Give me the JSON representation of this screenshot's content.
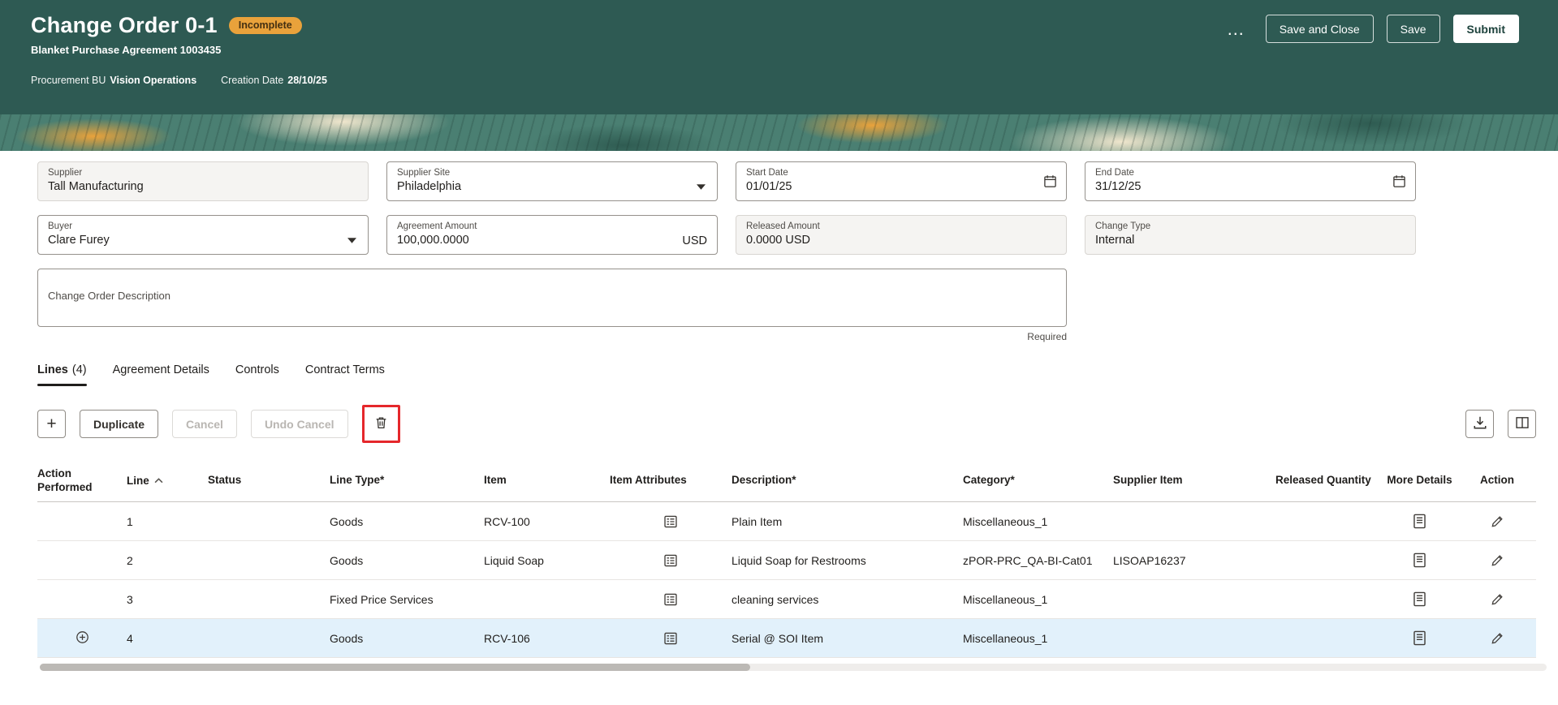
{
  "header": {
    "title": "Change Order 0-1",
    "status_badge": "Incomplete",
    "subtitle": "Blanket Purchase Agreement 1003435",
    "meta": {
      "procurement_bu_label": "Procurement BU",
      "procurement_bu_value": "Vision Operations",
      "creation_date_label": "Creation Date",
      "creation_date_value": "28/10/25"
    },
    "actions": {
      "more": "…",
      "save_and_close": "Save and Close",
      "save": "Save",
      "submit": "Submit"
    }
  },
  "form": {
    "supplier": {
      "label": "Supplier",
      "value": "Tall Manufacturing"
    },
    "supplier_site": {
      "label": "Supplier Site",
      "value": "Philadelphia"
    },
    "start_date": {
      "label": "Start Date",
      "value": "01/01/25"
    },
    "end_date": {
      "label": "End Date",
      "value": "31/12/25"
    },
    "buyer": {
      "label": "Buyer",
      "value": "Clare Furey"
    },
    "agreement_amount": {
      "label": "Agreement Amount",
      "value": "100,000.0000",
      "currency": "USD"
    },
    "released_amount": {
      "label": "Released Amount",
      "value": "0.0000 USD"
    },
    "change_type": {
      "label": "Change Type",
      "value": "Internal"
    },
    "description": {
      "label": "Change Order Description",
      "value": "",
      "required_hint": "Required"
    }
  },
  "tabs": [
    {
      "label": "Lines",
      "count": "(4)"
    },
    {
      "label": "Agreement Details",
      "count": ""
    },
    {
      "label": "Controls",
      "count": ""
    },
    {
      "label": "Contract Terms",
      "count": ""
    }
  ],
  "toolbar": {
    "add": "+",
    "duplicate": "Duplicate",
    "cancel": "Cancel",
    "undo_cancel": "Undo Cancel"
  },
  "table": {
    "columns": [
      "Action Performed",
      "Line",
      "Status",
      "Line Type*",
      "Item",
      "Item Attributes",
      "Description*",
      "Category*",
      "Supplier Item",
      "Released Quantity",
      "More Details",
      "Action"
    ],
    "rows": [
      {
        "action_performed": "",
        "line": "1",
        "status": "",
        "line_type": "Goods",
        "item": "RCV-100",
        "description": "Plain Item",
        "category": "Miscellaneous_1",
        "supplier_item": "",
        "released_quantity": ""
      },
      {
        "action_performed": "",
        "line": "2",
        "status": "",
        "line_type": "Goods",
        "item": "Liquid Soap",
        "description": "Liquid Soap for Restrooms",
        "category": "zPOR-PRC_QA-BI-Cat01",
        "supplier_item": "LISOAP16237",
        "released_quantity": ""
      },
      {
        "action_performed": "",
        "line": "3",
        "status": "",
        "line_type": "Fixed Price Services",
        "item": "",
        "description": "cleaning services",
        "category": "Miscellaneous_1",
        "supplier_item": "",
        "released_quantity": ""
      },
      {
        "action_performed": "added",
        "line": "4",
        "status": "",
        "line_type": "Goods",
        "item": "RCV-106",
        "description": "Serial @ SOI Item",
        "category": "Miscellaneous_1",
        "supplier_item": "",
        "released_quantity": ""
      }
    ]
  },
  "colors": {
    "header_background": "#2e5a53",
    "badge_background": "#e9a23b",
    "highlight_row": "#e2f1fb",
    "annotation_red": "#e5272b"
  }
}
